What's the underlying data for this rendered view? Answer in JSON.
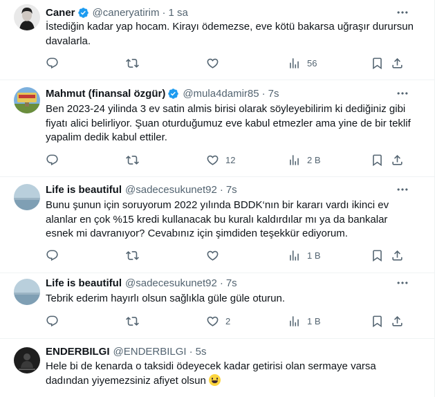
{
  "tweets": [
    {
      "name": "Caner",
      "verified": true,
      "handle": "@caneryatirim",
      "dot": "·",
      "time": "1 sa",
      "text": "İstediğin kadar yap hocam. Kirayı ödemezse, eve kötü bakarsa uğraşır durursun davalarla.",
      "reply_count": "",
      "retweet_count": "",
      "like_count": "",
      "views": "56"
    },
    {
      "name": "Mahmut (finansal özgür)",
      "verified": true,
      "handle": "@mula4damir85",
      "dot": "·",
      "time": "7s",
      "text": "Ben 2023-24 yilinda 3 ev satin almis birisi olarak söyleyebilirim ki dediğiniz gibi fiyatı alici belirliyor. Şuan oturduğumuz eve kabul etmezler ama yine de bir teklif yapalim dedik kabul ettiler.",
      "reply_count": "",
      "retweet_count": "",
      "like_count": "12",
      "views": "2 B"
    },
    {
      "name": "Life is beautiful",
      "verified": false,
      "handle": "@sadecesukunet92",
      "dot": "·",
      "time": "7s",
      "text": "Bunu şunun için soruyorum 2022 yılında BDDK‘nın bir kararı vardı ikinci ev alanlar en çok %15 kredi kullanacak bu kuralı kaldırdılar mı ya da bankalar esnek mi davranıyor? Cevabınız için şimdiden teşekkür ediyorum.",
      "reply_count": "",
      "retweet_count": "",
      "like_count": "",
      "views": "1 B"
    },
    {
      "name": "Life is beautiful",
      "verified": false,
      "handle": "@sadecesukunet92",
      "dot": "·",
      "time": "7s",
      "text": "Tebrik ederim hayırlı olsun sağlıkla güle güle oturun.",
      "reply_count": "",
      "retweet_count": "",
      "like_count": "2",
      "views": "1 B"
    },
    {
      "name": "ENDERBILGI",
      "verified": false,
      "handle": "@ENDERBILGI",
      "dot": "·",
      "time": "5s",
      "text": "Hele bi de kenarda o taksidi ödeyecek kadar getirisi olan sermaye varsa dadından yiyemezsiniz afiyet olsun",
      "text_emoji": "grinning-face-emoji"
    }
  ],
  "colors": {
    "text": "#0f1419",
    "muted": "#536471",
    "verified": "#1d9bf0",
    "divider": "#eff3f4"
  }
}
